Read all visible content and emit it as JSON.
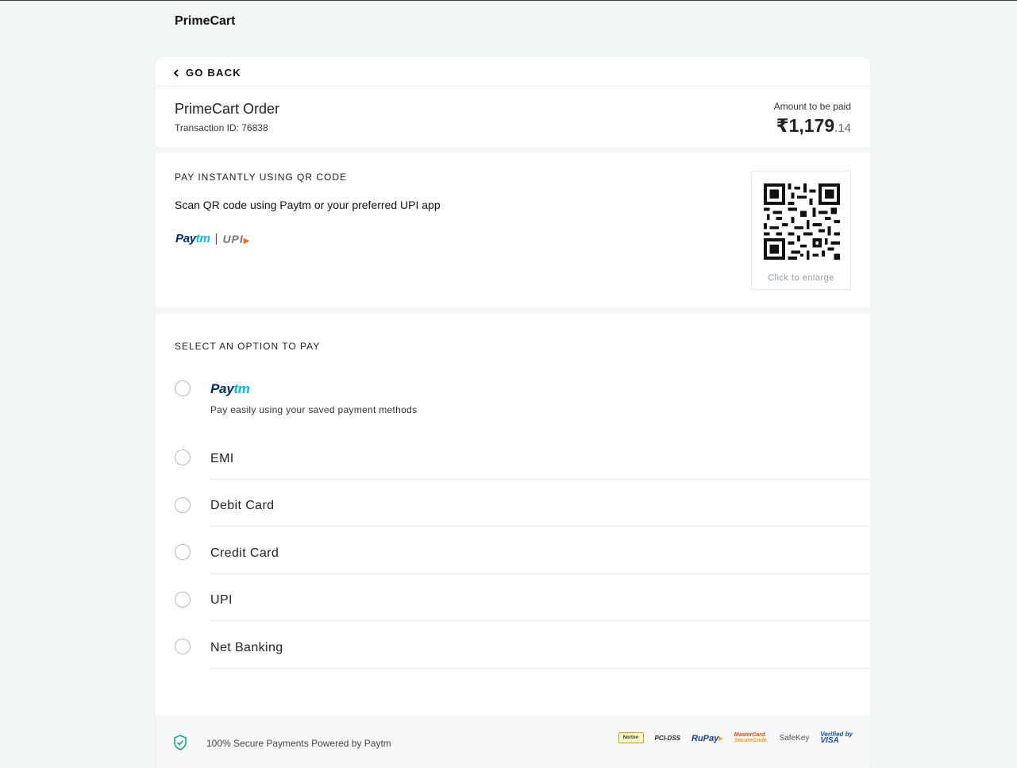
{
  "header": {
    "brand": "PrimeCart"
  },
  "nav": {
    "go_back": "GO BACK"
  },
  "order": {
    "title": "PrimeCart Order",
    "transaction": "Transaction ID: 76838",
    "amount_label": "Amount to be paid",
    "amount_main": "₹1,179",
    "amount_decimal": ".14"
  },
  "qr": {
    "heading": "PAY INSTANTLY USING QR CODE",
    "subtitle": "Scan QR code using Paytm or your preferred UPI app",
    "paytm_pay": "Pay",
    "paytm_tm": "tm",
    "separator": "|",
    "upi": "UPI",
    "caption": "Click to enlarge"
  },
  "options": {
    "heading": "SELECT AN OPTION TO PAY",
    "paytm_pay": "Pay",
    "paytm_tm": "tm",
    "paytm_desc": "Pay easily using your saved payment methods",
    "items": [
      "EMI",
      "Debit Card",
      "Credit Card",
      "UPI",
      "Net Banking"
    ]
  },
  "footer": {
    "secure": "100% Secure Payments Powered by Paytm",
    "badges": {
      "norton": "Norton",
      "pci": "PCI-DSS",
      "rupay_ru": "Ru",
      "rupay_pay": "Pay",
      "mastercard_1": "MasterCard.",
      "mastercard_2": "SecureCode.",
      "safekey": "SafeKey",
      "visa_1": "Verified by",
      "visa_2": "VISA"
    }
  },
  "colors": {
    "page_bg": "#f3f6f6",
    "card_bg": "#ffffff",
    "paytm_blue_dark": "#012b72",
    "paytm_blue_light": "#00b9f1",
    "shield_green": "#17a589"
  },
  "icons": [
    "chevron-left-icon",
    "qr-code",
    "shield-check-icon"
  ]
}
